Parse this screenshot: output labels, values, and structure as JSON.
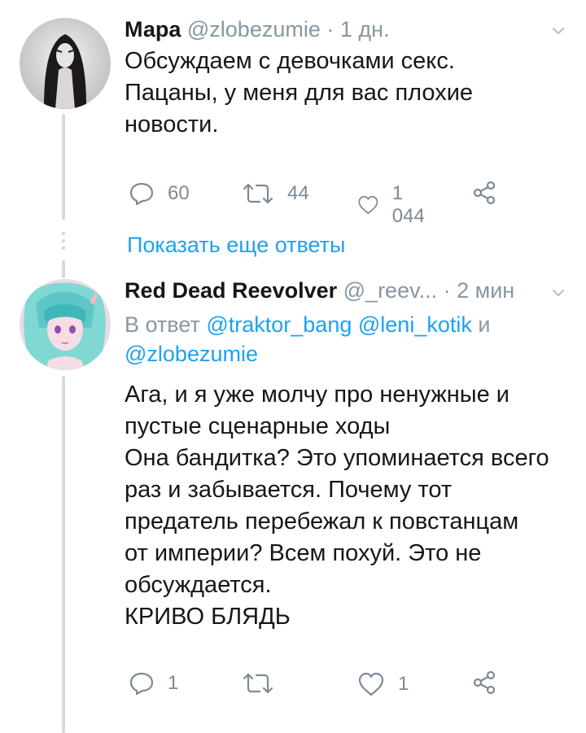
{
  "tweet1": {
    "name": "Мара",
    "handle": "@zlobezumie",
    "sep": "·",
    "time": "1 дн.",
    "lines": [
      "Обсуждаем с девочками секс.",
      "Пацаны, у меня для вас плохие",
      "новости."
    ],
    "replies": "60",
    "retweets": "44",
    "likes": "1 044"
  },
  "show_more": "Показать еще ответы",
  "tweet2": {
    "name": "Red Dead Reevolver",
    "handle": "@_reev...",
    "sep": "·",
    "time": "2 мин",
    "reply_prefix": "В ответ",
    "reply_mentions": [
      "@traktor_bang",
      "@leni_kotik"
    ],
    "reply_and": "и",
    "reply_last": "@zlobezumie",
    "lines": [
      "Ага, и я уже молчу про ненужные и",
      "пустые сценарные ходы",
      "Она бандитка? Это упоминается всего",
      "раз и забывается. Почему тот",
      "предатель перебежал к повстанцам",
      "от империи? Всем похуй. Это не",
      "обсуждается.",
      "КРИВО БЛЯДЬ"
    ],
    "replies": "1",
    "retweets": "",
    "likes": "1"
  },
  "colors": {
    "link": "#1da1f2",
    "muted": "#8796a3",
    "icon": "#7c8a97"
  }
}
